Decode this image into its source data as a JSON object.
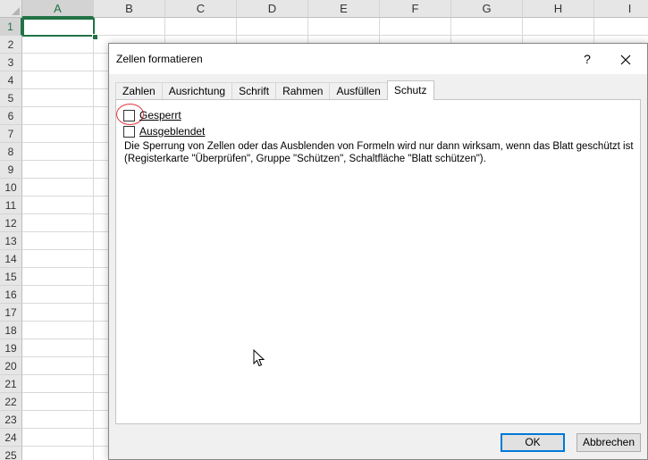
{
  "spreadsheet": {
    "columns": [
      "A",
      "B",
      "C",
      "D",
      "E",
      "F",
      "G",
      "H",
      "I"
    ],
    "rows": [
      "1",
      "2",
      "3",
      "4",
      "5",
      "6",
      "7",
      "8",
      "9",
      "10",
      "11",
      "12",
      "13",
      "14",
      "15",
      "16",
      "17",
      "18",
      "19",
      "20",
      "21",
      "22",
      "23",
      "24",
      "25"
    ],
    "active_column": "A",
    "active_row": "1",
    "accent_color": "#217346"
  },
  "dialog": {
    "title": "Zellen formatieren",
    "help_label": "?",
    "close_icon": "close-icon",
    "tabs": [
      {
        "label": "Zahlen"
      },
      {
        "label": "Ausrichtung"
      },
      {
        "label": "Schrift"
      },
      {
        "label": "Rahmen"
      },
      {
        "label": "Ausfüllen"
      },
      {
        "label": "Schutz",
        "selected": true
      }
    ],
    "protection": {
      "locked_label": "Gesperrt",
      "locked_checked": false,
      "hidden_label": "Ausgeblendet",
      "hidden_checked": false,
      "note": "Die Sperrung von Zellen oder das Ausblenden von Formeln wird nur dann wirksam, wenn das Blatt geschützt ist (Registerkarte \"Überprüfen\", Gruppe \"Schützen\", Schaltfläche \"Blatt schützen\")."
    },
    "ok_label": "OK",
    "cancel_label": "Abbrechen",
    "highlight_color": "#e0393e",
    "focus_color": "#0078d7"
  }
}
